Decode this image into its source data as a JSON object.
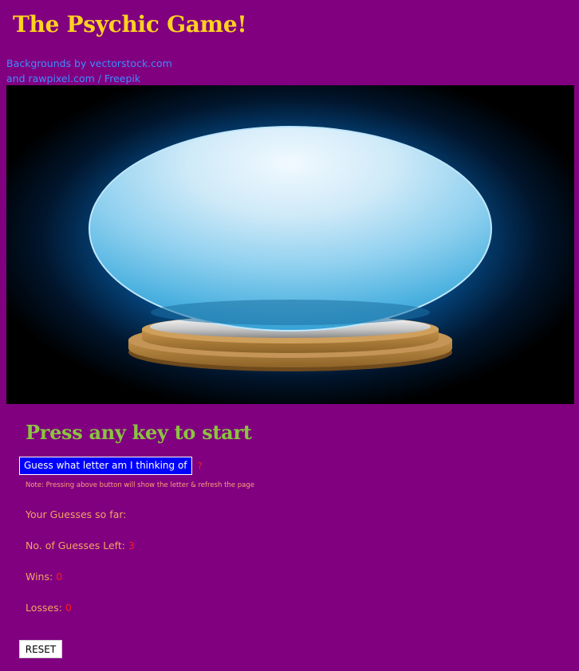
{
  "header": {
    "title": "The Psychic Game!"
  },
  "credits": {
    "line1": "Backgrounds by vectorstock.com",
    "line2": "and rawpixel.com / Freepik"
  },
  "game": {
    "start_prompt": "Press any key to start",
    "guess_button_label": "Guess what letter am I thinking of",
    "answer_placeholder": "?",
    "note": "Note: Pressing above button will show the letter & refresh the page",
    "guesses_label": "Your Guesses so far:",
    "guesses_value": "",
    "guesses_left_label": "No. of Guesses Left:",
    "guesses_left_value": "3",
    "wins_label": "Wins:",
    "wins_value": "0",
    "losses_label": "Losses:",
    "losses_value": "0",
    "reset_label": "RESET"
  },
  "colors": {
    "background": "#800080",
    "title": "#ffd21f",
    "start_prompt": "#8bc43f",
    "link": "#3e8cff",
    "stat_label": "#f4a460",
    "stat_value": "#ff1a1a",
    "guess_button": "#0000ff"
  }
}
